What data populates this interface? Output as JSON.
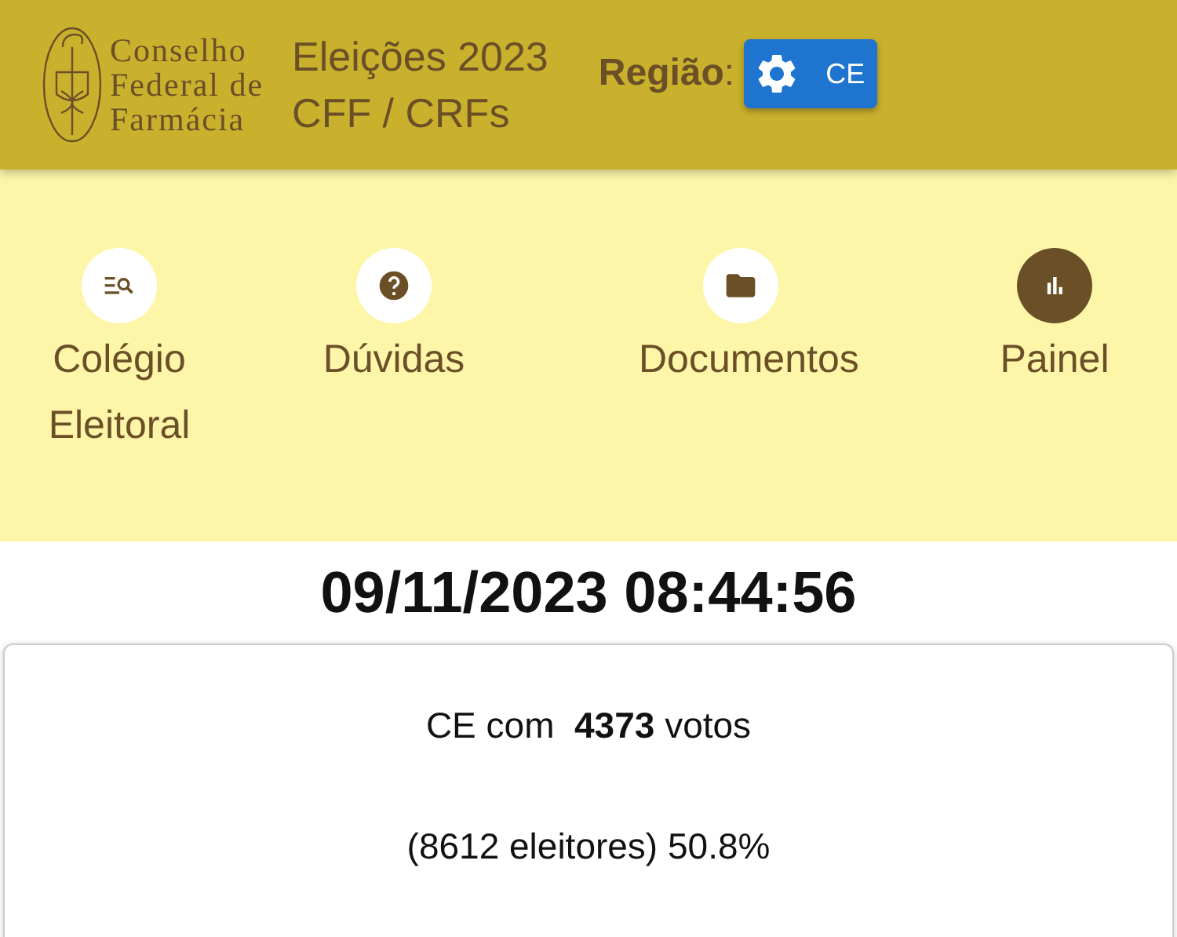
{
  "header": {
    "logo_lines": [
      "Conselho",
      "Federal de",
      "Farmácia"
    ],
    "title_lines": [
      "Eleições 2023",
      "CFF / CRFs"
    ],
    "region_label": "Região",
    "region_separator": ":",
    "region_button": "CE"
  },
  "nav": [
    {
      "kind": "search-list",
      "label": "Colégio Eleitoral",
      "selected": false
    },
    {
      "kind": "help",
      "label": "Dúvidas",
      "selected": false
    },
    {
      "kind": "folder",
      "label": "Documentos",
      "selected": false
    },
    {
      "kind": "chart",
      "label": "Painel",
      "selected": true
    }
  ],
  "timestamp": "09/11/2023 08:44:56",
  "card": {
    "lines": [
      "CE com  **4373** votos",
      "(8612 eleitores) 50.8%"
    ]
  }
}
